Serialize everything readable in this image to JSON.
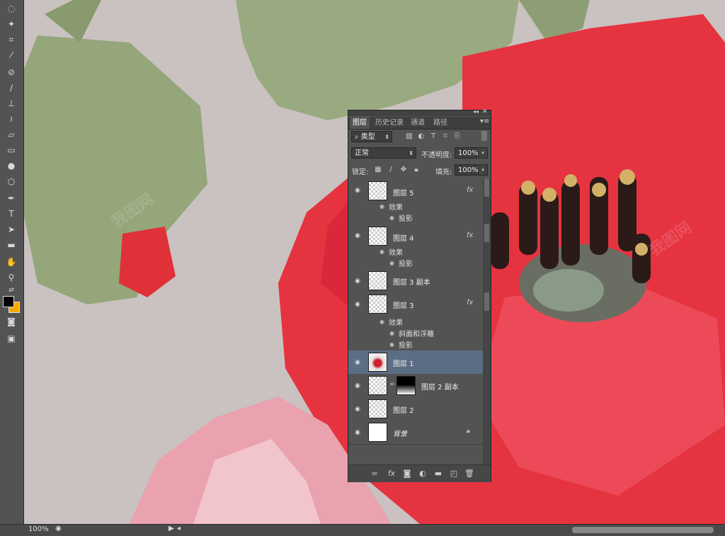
{
  "status_bar": {
    "zoom": "100%"
  },
  "panel": {
    "tabs": [
      "图层",
      "历史记录",
      "通道",
      "路径"
    ],
    "filter_label": "类型",
    "blend_mode": "正常",
    "opacity_label": "不透明度:",
    "opacity_value": "100%",
    "lock_label": "锁定:",
    "fill_label": "填充:",
    "fill_value": "100%",
    "fx_label": "fx",
    "layers": [
      {
        "name": "图层 5",
        "has_fx": true,
        "effects_label": "效果",
        "effects": [
          "投影"
        ]
      },
      {
        "name": "图层 4",
        "has_fx": true,
        "effects_label": "效果",
        "effects": [
          "投影"
        ]
      },
      {
        "name": "图层 3 副本",
        "has_fx": false
      },
      {
        "name": "图层 3",
        "has_fx": true,
        "effects_label": "效果",
        "effects": [
          "斜面和浮雕",
          "投影"
        ]
      },
      {
        "name": "图层 1",
        "has_fx": false,
        "selected": true
      },
      {
        "name": "图层 2 副本",
        "has_fx": false,
        "has_mask": true
      },
      {
        "name": "图层 2",
        "has_fx": false
      },
      {
        "name": "背景",
        "has_fx": false,
        "locked": true
      }
    ]
  },
  "watermark_text": "我图网",
  "colors": {
    "foreground": "#000000",
    "background": "#f5a800",
    "selected_row": "#5b6e86",
    "panel_bg": "#535353"
  },
  "icons": {
    "tools": [
      "lasso-icon",
      "magic-wand-icon",
      "crop-icon",
      "eyedropper-icon",
      "healing-brush-icon",
      "brush-icon",
      "clone-stamp-icon",
      "history-brush-icon",
      "eraser-icon",
      "gradient-icon",
      "blur-icon",
      "dodge-icon",
      "pen-icon",
      "type-icon",
      "path-select-icon",
      "rectangle-icon",
      "hand-icon",
      "zoom-icon"
    ]
  }
}
